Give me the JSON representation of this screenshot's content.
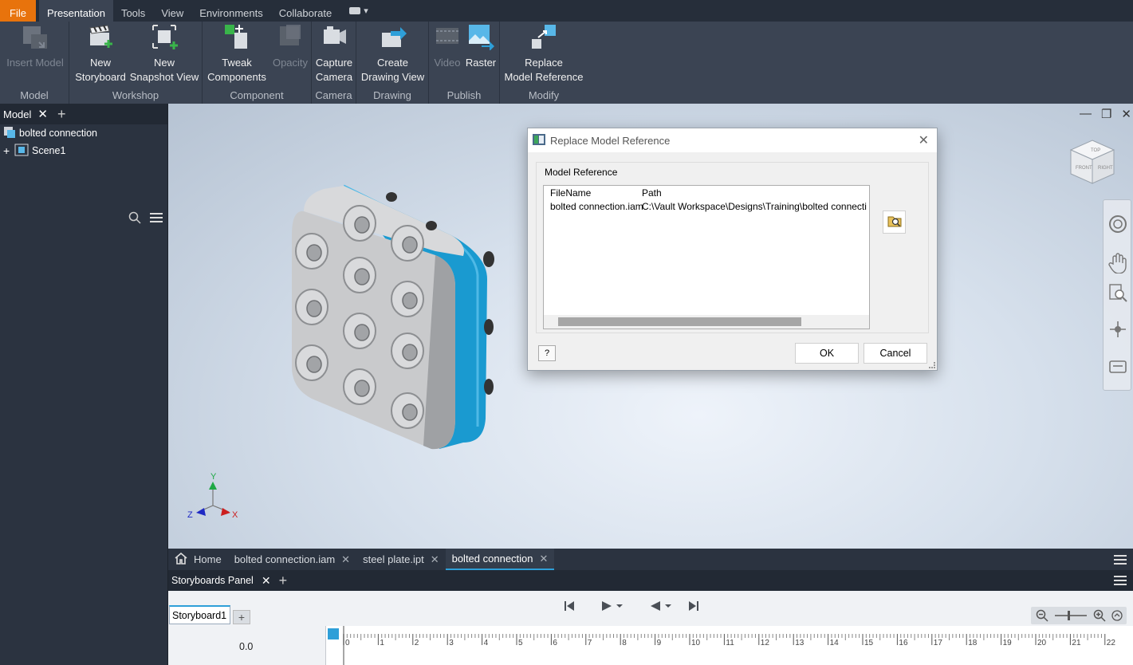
{
  "menubar": {
    "tabs": [
      "File",
      "Presentation",
      "Tools",
      "View",
      "Environments",
      "Collaborate"
    ],
    "active": "Presentation"
  },
  "ribbon": {
    "panels": {
      "model": "Model",
      "workshop": "Workshop",
      "component": "Component",
      "camera": "Camera",
      "drawing": "Drawing",
      "publish": "Publish",
      "modify": "Modify"
    },
    "buttons": {
      "insert_model": "Insert Model",
      "new_storyboard_1": "New",
      "new_storyboard_2": "Storyboard",
      "new_snapshot_1": "New",
      "new_snapshot_2": "Snapshot View",
      "tweak_1": "Tweak",
      "tweak_2": "Components",
      "opacity": "Opacity",
      "capture_1": "Capture",
      "capture_2": "Camera",
      "create_dv_1": "Create",
      "create_dv_2": "Drawing View",
      "video": "Video",
      "raster": "Raster",
      "replace_1": "Replace",
      "replace_2": "Model Reference"
    }
  },
  "browser": {
    "tab_label": "Model",
    "items": [
      {
        "label": "bolted connection"
      },
      {
        "label": "Scene1"
      }
    ]
  },
  "dialog": {
    "title": "Replace Model Reference",
    "group_title": "Model Reference",
    "columns": [
      "FileName",
      "Path"
    ],
    "rows": [
      {
        "filename": "bolted connection.iam",
        "path": "C:\\Vault Workspace\\Designs\\Training\\bolted connecti"
      }
    ],
    "ok_label": "OK",
    "cancel_label": "Cancel",
    "help_label": "?"
  },
  "doc_tabs": {
    "home": "Home",
    "tabs": [
      "bolted connection.iam",
      "steel plate.ipt",
      "bolted connection"
    ],
    "active_index": 2
  },
  "storyboards": {
    "panel_title": "Storyboards Panel",
    "tab_label": "Storyboard1",
    "time_value": "0.0",
    "ticks": [
      "0",
      "1",
      "2",
      "3",
      "4",
      "5",
      "6",
      "7",
      "8",
      "9",
      "10",
      "11",
      "12",
      "13",
      "14",
      "15",
      "16",
      "17",
      "18",
      "19",
      "20",
      "21",
      "22"
    ]
  },
  "axes": {
    "x": "X",
    "y": "Y",
    "z": "Z"
  },
  "viewcube": {
    "front": "FRONT",
    "right": "RIGHT",
    "top": "TOP"
  },
  "colors": {
    "accent_orange": "#e8730c",
    "accent_blue": "#2e9fd8",
    "ribbon_bg": "#3b4453",
    "plate_blue": "#1a9ad0"
  }
}
